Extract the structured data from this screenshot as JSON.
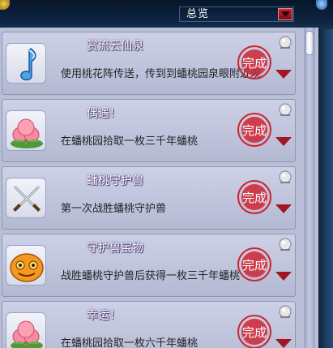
{
  "header": {
    "dropdown_value": "总览",
    "colors": {
      "accent": "#b8141d",
      "panel": "#bfc4dc"
    }
  },
  "entries": [
    {
      "title": "赏流云仙泉",
      "desc": "使用桃花阵传送，传到到蟠桃园泉眼附近观",
      "icon": "music-note-icon",
      "stamp": "完成"
    },
    {
      "title": "偶遇！",
      "desc": "在蟠桃园拾取一枚三千年蟠桃",
      "icon": "peach-icon",
      "stamp": "完成"
    },
    {
      "title": "蟠桃守护兽",
      "desc": "第一次战胜蟠桃守护兽",
      "icon": "crossed-swords-icon",
      "stamp": "完成"
    },
    {
      "title": "守护兽宝物",
      "desc": "战胜蟠桃守护兽后获得一枚三千年蟠桃",
      "icon": "orange-monster-icon",
      "stamp": "完成"
    },
    {
      "title": "幸运！",
      "desc": "在蟠桃园拾取一枚六千年蟠桃",
      "icon": "peach-icon",
      "stamp": "完成"
    }
  ]
}
